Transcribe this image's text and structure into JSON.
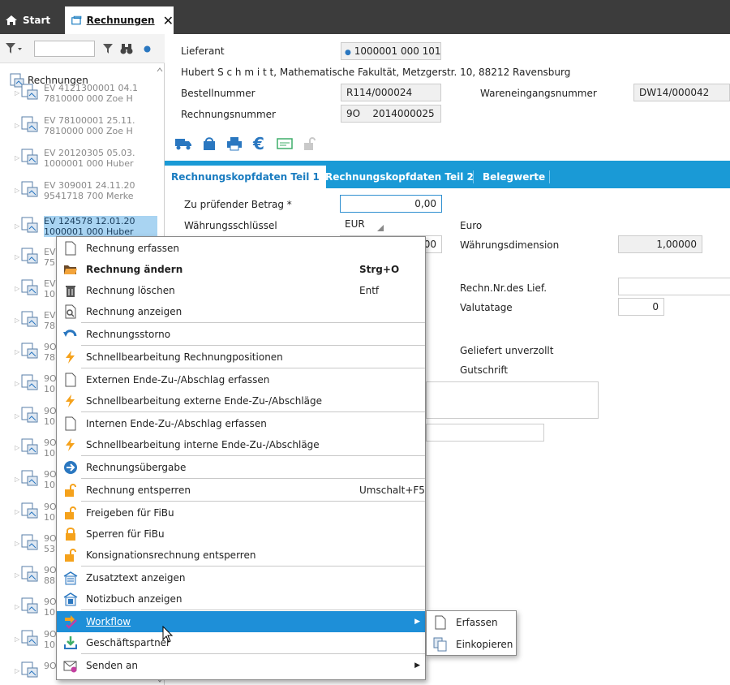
{
  "tabs": {
    "start_label": "Start",
    "rechnungen_label": "Rechnungen",
    "close_glyph": "✕"
  },
  "sidebar": {
    "filter_value": "",
    "root_label": "Rechnungen",
    "items": [
      {
        "line1": "EV 4121300001 04.1",
        "line2": "7810000 000 Zoe H",
        "selected": false
      },
      {
        "line1": "EV 78100001 25.11.",
        "line2": "7810000 000 Zoe H",
        "selected": false
      },
      {
        "line1": "EV 20120305 05.03.",
        "line2": "1000001 000 Huber",
        "selected": false
      },
      {
        "line1": "EV 309001 24.11.20",
        "line2": "9541718 700 Merke",
        "selected": false
      },
      {
        "line1": "EV 124578 12.01.20",
        "line2": "1000001 000 Huber",
        "selected": true
      },
      {
        "line1": "EV",
        "line2": "75",
        "selected": false
      },
      {
        "line1": "EV",
        "line2": "10",
        "selected": false
      },
      {
        "line1": "EV",
        "line2": "78",
        "selected": false
      },
      {
        "line1": "9O",
        "line2": "78",
        "selected": false
      },
      {
        "line1": "9O",
        "line2": "10",
        "selected": false
      },
      {
        "line1": "9O",
        "line2": "10",
        "selected": false
      },
      {
        "line1": "9O",
        "line2": "10",
        "selected": false
      },
      {
        "line1": "9O",
        "line2": "10",
        "selected": false
      },
      {
        "line1": "9O",
        "line2": "10",
        "selected": false
      },
      {
        "line1": "9O",
        "line2": "53",
        "selected": false
      },
      {
        "line1": "9O",
        "line2": "88",
        "selected": false
      },
      {
        "line1": "9O",
        "line2": "10",
        "selected": false
      },
      {
        "line1": "9O",
        "line2": "10",
        "selected": false
      },
      {
        "line1": "9O 2014000013 23.",
        "line2": "",
        "selected": false
      }
    ]
  },
  "header": {
    "lieferant_label": "Lieferant",
    "lieferant_value": "1000001 000 101",
    "address": "Hubert S c h m i t t, Mathematische Fakultät, Metzgerstr. 10, 88212 Ravensburg",
    "bestellnummer_label": "Bestellnummer",
    "bestellnummer_value": "R114/000024",
    "wareneingang_label": "Wareneingangsnummer",
    "wareneingang_value": "DW14/000042",
    "rechnungsnummer_label": "Rechnungsnummer",
    "rechnungsnummer_value": "9O    2014000025"
  },
  "panel_tabs": [
    "Rechnungskopfdaten Teil 1",
    "Rechnungskopfdaten Teil 2",
    "Belegwerte"
  ],
  "form": {
    "betrag_label": "Zu prüfender Betrag *",
    "betrag_value": "0,00",
    "waehrung_label": "Währungsschlüssel",
    "waehrung_value": "EUR",
    "waehrung_name": "Euro",
    "hidden_value_fragment": "00",
    "dimension_label": "Währungsdimension",
    "dimension_value": "1,00000",
    "rechn_nr_lief_label": "Rechn.Nr.des Lief.",
    "rechn_nr_lief_value": "",
    "valutatage_label": "Valutatage",
    "valutatage_value": "0",
    "geliefert_label": "Geliefert unverzollt",
    "gutschrift_label": "Gutschrift"
  },
  "context_menu": {
    "items": [
      {
        "label": "Rechnung erfassen",
        "shortcut": "",
        "icon": "page-icon"
      },
      {
        "label": "Rechnung ändern",
        "shortcut": "Strg+O",
        "icon": "folder-open-icon",
        "bold": true
      },
      {
        "label": "Rechnung löschen",
        "shortcut": "Entf",
        "icon": "trash-icon"
      },
      {
        "label": "Rechnung anzeigen",
        "shortcut": "",
        "icon": "page-search-icon"
      },
      {
        "label": "Rechnungsstorno",
        "shortcut": "",
        "icon": "undo-icon"
      },
      {
        "label": "Schnellbearbeitung Rechnungpositionen",
        "shortcut": "",
        "icon": "lightning-icon"
      },
      {
        "label": "Externen Ende-Zu-/Abschlag erfassen",
        "shortcut": "",
        "icon": "page-icon"
      },
      {
        "label": "Schnellbearbeitung externe Ende-Zu-/Abschläge",
        "shortcut": "",
        "icon": "lightning-icon"
      },
      {
        "label": "Internen Ende-Zu-/Abschlag erfassen",
        "shortcut": "",
        "icon": "page-icon"
      },
      {
        "label": "Schnellbearbeitung interne Ende-Zu-/Abschläge",
        "shortcut": "",
        "icon": "lightning-icon"
      },
      {
        "label": "Rechnungsübergabe",
        "shortcut": "",
        "icon": "arrow-right-circle-icon"
      },
      {
        "label": "Rechnung entsperren",
        "shortcut": "Umschalt+F5",
        "icon": "unlock-icon"
      },
      {
        "label": "Freigeben für FiBu",
        "shortcut": "",
        "icon": "unlock-icon"
      },
      {
        "label": "Sperren für FiBu",
        "shortcut": "",
        "icon": "lock-icon"
      },
      {
        "label": "Konsignationsrechnung entsperren",
        "shortcut": "",
        "icon": "unlock-icon"
      },
      {
        "label": "Zusatztext anzeigen",
        "shortcut": "",
        "icon": "text-attachment-icon"
      },
      {
        "label": "Notizbuch anzeigen",
        "shortcut": "",
        "icon": "notebook-icon"
      },
      {
        "label": "Workflow",
        "shortcut": "",
        "icon": "workflow-icon",
        "highlighted": true,
        "submenu": true
      },
      {
        "label": "Geschäftspartner",
        "shortcut": "",
        "icon": "download-icon"
      },
      {
        "label": "Senden an",
        "shortcut": "",
        "icon": "envelope-icon",
        "submenu": true
      }
    ]
  },
  "submenu": {
    "items": [
      {
        "label": "Erfassen",
        "icon": "page-icon"
      },
      {
        "label": "Einkopieren",
        "icon": "copy-icon"
      }
    ]
  },
  "colors": {
    "topbar": "#3c3c3c",
    "accent": "#1a9ad6",
    "highlight": "#1e8fd8",
    "icon_blue": "#2a77c0",
    "icon_orange": "#f5a21c"
  }
}
